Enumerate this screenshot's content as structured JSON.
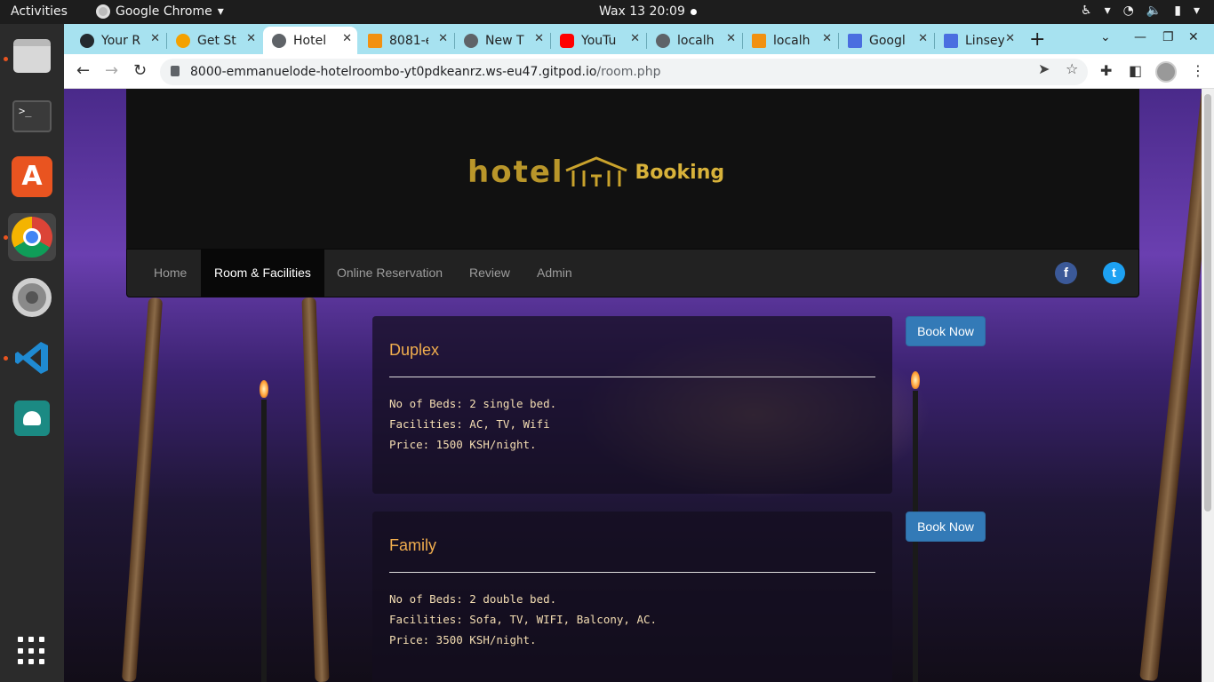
{
  "os": {
    "activities": "Activities",
    "app_name": "Google Chrome",
    "clock": "Wax 13  20:09"
  },
  "browser": {
    "tabs": [
      {
        "title": "Your R",
        "icon": "github-icon",
        "color": "#24292e"
      },
      {
        "title": "Get St",
        "icon": "getstarted-icon",
        "color": "#f4a100"
      },
      {
        "title": "Hotel",
        "icon": "globe-icon",
        "color": "#5f6368",
        "active": true
      },
      {
        "title": "8081-e",
        "icon": "phpmyadmin-icon",
        "color": "#f29111"
      },
      {
        "title": "New T",
        "icon": "chrome-icon",
        "color": "#5f6368"
      },
      {
        "title": "YouTu",
        "icon": "youtube-icon",
        "color": "#ff0000"
      },
      {
        "title": "localh",
        "icon": "globe-icon",
        "color": "#5f6368"
      },
      {
        "title": "localh",
        "icon": "phpmyadmin-icon",
        "color": "#f29111"
      },
      {
        "title": "Googl",
        "icon": "docs-icon",
        "color": "#4a6ee0"
      },
      {
        "title": "Linsey",
        "icon": "docs-icon",
        "color": "#4a6ee0"
      }
    ],
    "url_host": "8000-emmanuelode-hotelroombo-yt0pdkeanrz.ws-eu47.gitpod.io",
    "url_path": "/room.php"
  },
  "site": {
    "logo_left": "hotel",
    "logo_right": "Booking",
    "nav": [
      "Home",
      "Room & Facilities",
      "Online Reservation",
      "Review",
      "Admin"
    ],
    "active_nav": "Room & Facilities",
    "social": {
      "facebook": "f",
      "twitter": "t"
    }
  },
  "rooms": [
    {
      "name": "Duplex",
      "beds": "No of Beds: 2 single bed.",
      "facilities": "Facilities: AC, TV, Wifi",
      "price": "Price: 1500 KSH/night.",
      "button": "Book Now"
    },
    {
      "name": "Family",
      "beds": "No of Beds: 2 double bed.",
      "facilities": "Facilities: Sofa, TV, WIFI, Balcony, AC.",
      "price": "Price: 3500 KSH/night.",
      "button": "Book Now"
    }
  ],
  "colors": {
    "room_title": "#f0ad4e",
    "button": "#337ab7",
    "navbar": "#222222",
    "tabstrip": "#a7e2f0"
  }
}
